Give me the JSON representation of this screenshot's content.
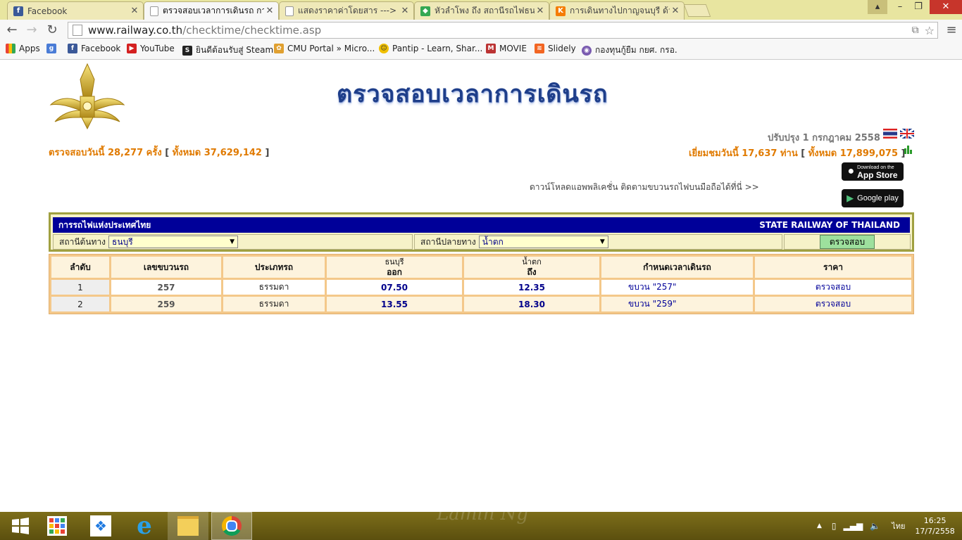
{
  "browser": {
    "tabs": [
      {
        "label": "Facebook",
        "icon": "facebook-icon",
        "color": "#3b5998",
        "glyph": "f",
        "active": false
      },
      {
        "label": "ตรวจสอบเวลาการเดินรถ การร",
        "icon": "page-icon",
        "color": "#ffffff",
        "glyph": "",
        "active": true
      },
      {
        "label": "แสดงราคาค่าโดยสาร ---> กา",
        "icon": "page-icon",
        "color": "#ffffff",
        "glyph": "",
        "active": false
      },
      {
        "label": "หัวลำโพง ถึง สถานีรถไฟธนบุรี",
        "icon": "maps-icon",
        "color": "#34a853",
        "glyph": "",
        "active": false
      },
      {
        "label": "การเดินทางไปกาญจนบุรี ด้วย",
        "icon": "k-icon",
        "color": "#f57c00",
        "glyph": "K",
        "active": false
      }
    ],
    "url_host": "www.railway.co.th",
    "url_path": "/checktime/checktime.asp",
    "bookmarks": [
      {
        "label": "Apps",
        "icon": "apps-icon"
      },
      {
        "label": "",
        "icon": "google-icon"
      },
      {
        "label": "Facebook",
        "icon": "facebook-icon"
      },
      {
        "label": "YouTube",
        "icon": "youtube-icon"
      },
      {
        "label": "ยินดีต้อนรับสู่ Steam",
        "icon": "steam-icon"
      },
      {
        "label": "CMU Portal » Micro...",
        "icon": "cmu-icon"
      },
      {
        "label": "Pantip - Learn, Shar...",
        "icon": "pantip-icon"
      },
      {
        "label": "MOVIE",
        "icon": "movie-icon"
      },
      {
        "label": "Slidely",
        "icon": "slidely-icon"
      },
      {
        "label": "กองทุนกู้ยืม กยศ. กรอ.",
        "icon": "fund-icon"
      }
    ]
  },
  "header": {
    "title": "ตรวจสอบเวลาการเดินรถ",
    "updated": "ปรับปรุง 1 กรกฎาคม 2558",
    "check_today_label": "ตรวจสอบวันนี้",
    "check_today": "28,277",
    "times_unit": "ครั้ง",
    "total_label": "ทั้งหมด",
    "check_total": "37,629,142",
    "visit_label": "เยี่ยมชมวันนี้",
    "visit_today": "17,637",
    "visit_unit": "ท่าน",
    "visit_total": "17,899,075",
    "app_text": "ดาวน์โหลดแอพพลิเคชั่น ติดตามขบวนรถไฟบนมือถือได้ที่นี่ >>",
    "appstore": "App Store",
    "appstore_small": "Download on the",
    "googleplay": "Google play"
  },
  "search": {
    "org_th": "การรถไฟแห่งประเทศไทย",
    "org_en": "STATE RAILWAY OF THAILAND",
    "origin_label": "สถานีต้นทาง",
    "origin_value": "ธนบุรี",
    "dest_label": "สถานีปลายทาง",
    "dest_value": "น้ำตก",
    "submit": "ตรวจสอบ"
  },
  "results": {
    "headers": {
      "seq": "ลำดับ",
      "train_no": "เลขขบวนรถ",
      "type": "ประเภทรถ",
      "origin": "ธนบุรี",
      "depart": "ออก",
      "dest": "น้ำตก",
      "arrive": "ถึง",
      "schedule": "กำหนดเวลาเดินรถ",
      "price": "ราคา"
    },
    "rows": [
      {
        "seq": "1",
        "train_no": "257",
        "type": "ธรรมดา",
        "depart": "07.50",
        "arrive": "12.35",
        "schedule": "ขบวน \"257\"",
        "price": "ตรวจสอบ"
      },
      {
        "seq": "2",
        "train_no": "259",
        "type": "ธรรมดา",
        "depart": "13.55",
        "arrive": "18.30",
        "schedule": "ขบวน \"259\"",
        "price": "ตรวจสอบ"
      }
    ]
  },
  "taskbar": {
    "time": "16:25",
    "date": "17/7/2558",
    "lang": "ไทย",
    "watermark": "Lamin Ng"
  }
}
